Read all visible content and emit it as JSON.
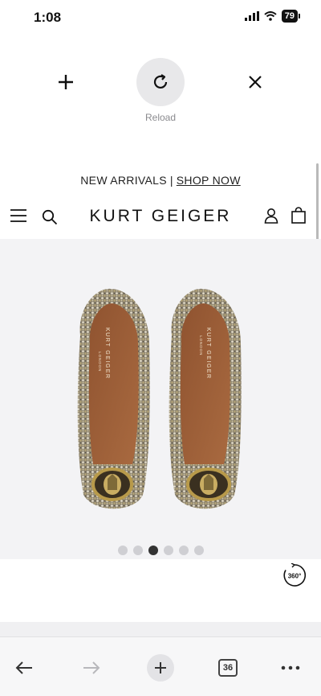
{
  "status_bar": {
    "time": "1:08",
    "battery": "79"
  },
  "pull_refresh": {
    "reload_label": "Reload"
  },
  "announcement": {
    "text": "NEW ARRIVALS",
    "separator": "|",
    "link": "SHOP NOW"
  },
  "header": {
    "logo": "KURT GEIGER"
  },
  "product": {
    "insole_brand": "KURT GEIGER",
    "insole_city": "LONDON",
    "gallery": {
      "total_images": 6,
      "active_index": 3
    },
    "viewer_360_label": "360°"
  },
  "toolbar": {
    "tab_count": "36"
  },
  "colors": {
    "accent": "#111111",
    "image_bg": "#f3f3f5"
  }
}
